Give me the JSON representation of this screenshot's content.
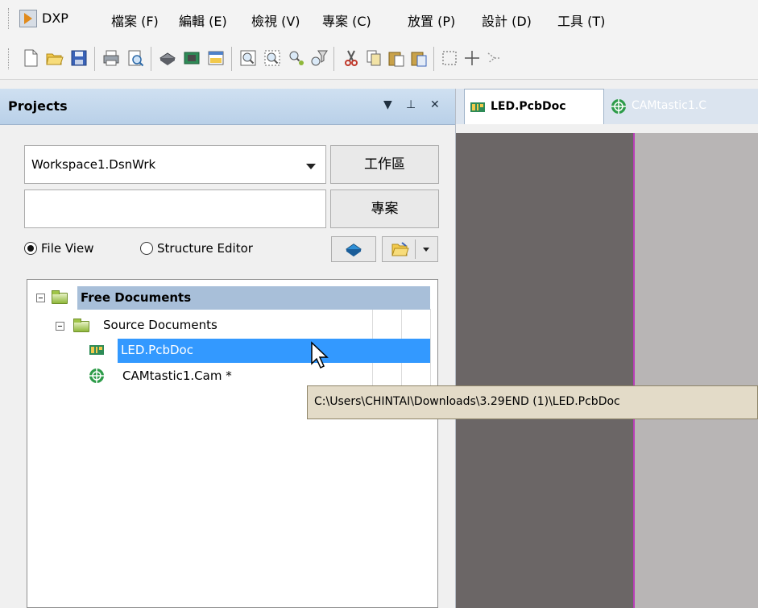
{
  "menubar": {
    "logo_label": "DXP",
    "items": [
      "檔案 (F)",
      "編輯 (E)",
      "檢視 (V)",
      "專案 (C)",
      "放置 (P)",
      "設計 (D)",
      "工具 (T)"
    ]
  },
  "toolbar": {
    "icons": [
      "new-document-icon",
      "open-folder-icon",
      "save-icon",
      "print-icon",
      "print-preview-icon",
      "chip-icon",
      "board-icon",
      "window-icon",
      "zoom-fit-icon",
      "zoom-area-icon",
      "zoom-selected-icon",
      "filter-icon",
      "cut-icon",
      "copy-icon",
      "paste-icon",
      "paste-special-icon",
      "select-rect-icon",
      "move-icon",
      "deselect-icon"
    ]
  },
  "projects_panel": {
    "title": "Projects",
    "workspace_combo_value": "Workspace1.DsnWrk",
    "workspace_button": "工作區",
    "project_input_value": "",
    "project_button": "專案",
    "radio_file_view": "File View",
    "radio_structure_editor": "Structure Editor",
    "selected_view": "File View",
    "tree": {
      "root": "Free Documents",
      "group": "Source Documents",
      "items": [
        {
          "label": "LED.PcbDoc",
          "icon": "pcb-document-icon",
          "selected": true
        },
        {
          "label": "CAMtastic1.Cam *",
          "icon": "cam-document-icon",
          "selected": false
        }
      ]
    }
  },
  "document_tabs": [
    {
      "label": "LED.PcbDoc",
      "icon": "pcb-document-icon",
      "active": true
    },
    {
      "label": "CAMtastic1.C",
      "icon": "cam-document-icon",
      "active": false
    }
  ],
  "tooltip": {
    "text": "C:\\Users\\CHINTAI\\Downloads\\3.29END (1)\\LED.PcbDoc"
  },
  "colors": {
    "panel_header": "#c3d7ec",
    "selection": "#3399ff",
    "root_highlight": "#a8bfd9",
    "pcb_board": "#6b6666",
    "board_outline": "#b83fb8",
    "tooltip_bg": "#e3dbc8"
  }
}
